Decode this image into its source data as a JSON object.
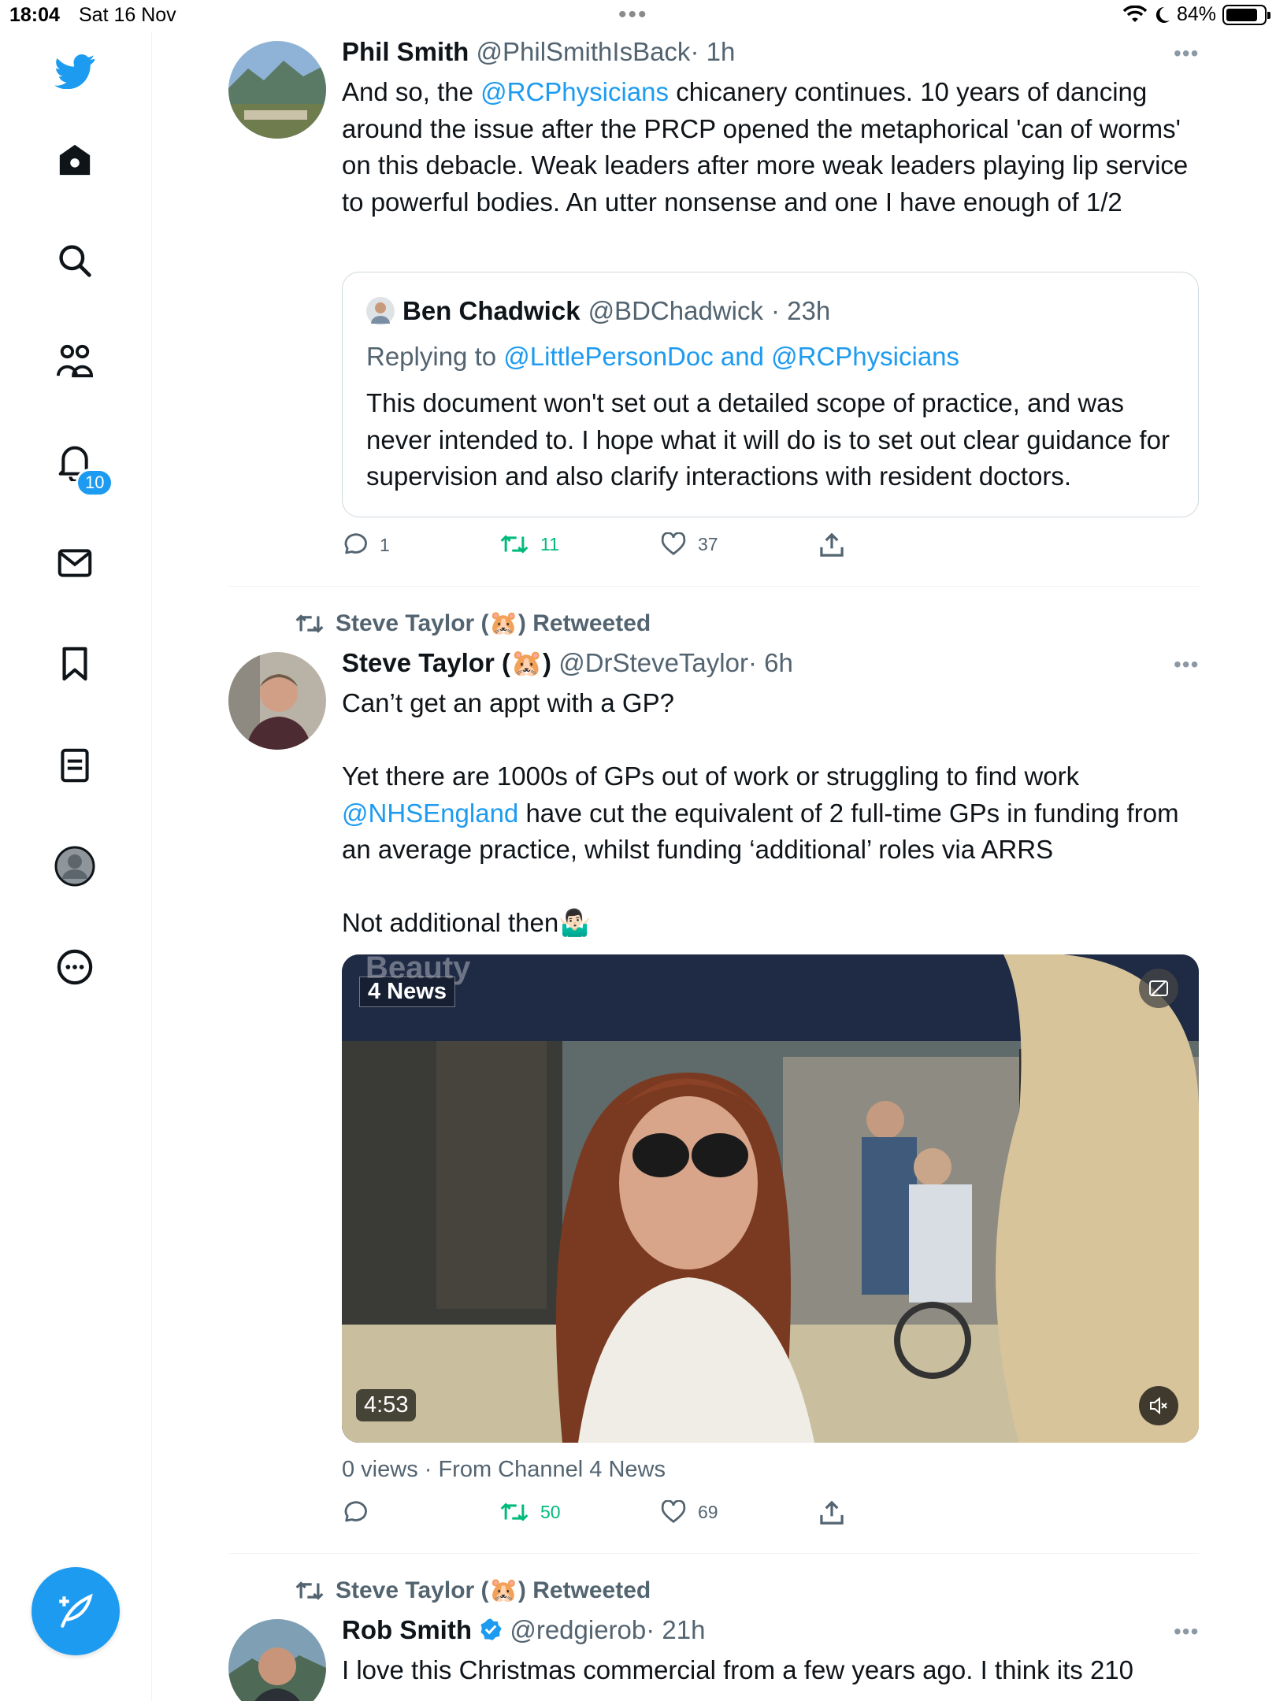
{
  "status_bar": {
    "time": "18:04",
    "date": "Sat 16 Nov",
    "battery": "84%",
    "battery_level": 0.84
  },
  "sidebar": {
    "items": [
      "twitter-logo",
      "home-icon",
      "search-icon",
      "communities-icon",
      "notifications-icon",
      "messages-icon",
      "bookmarks-icon",
      "lists-icon",
      "profile-icon",
      "more-icon"
    ],
    "notification_count": "10"
  },
  "tweet1": {
    "name": "Phil Smith",
    "handle": "@PhilSmithIsBack",
    "time": "· 1h",
    "text_pre": "And so, the ",
    "mention": "@RCPhysicians",
    "text_post": " chicanery continues. 10 years of dancing around the issue after the PRCP opened the metaphorical 'can of worms' on this debacle. Weak leaders after more weak leaders playing lip service to powerful bodies. An utter nonsense and one I have enough of 1/2",
    "quote": {
      "name": "Ben Chadwick",
      "handle": "@BDChadwick",
      "time": "· 23h",
      "replying_to_label": "Replying to",
      "replying_to_users": "@LittlePersonDoc and @RCPhysicians",
      "text": "This document won't set out a detailed scope of practice, and was never intended to. I hope what it will do is to set out clear guidance for supervision and also clarify interactions with resident doctors."
    },
    "replies": "1",
    "retweets": "11",
    "likes": "37"
  },
  "tweet2": {
    "retweeted_by": "Steve Taylor (🐹) Retweeted",
    "name": "Steve Taylor (🐹)",
    "handle": "@DrSteveTaylor",
    "time": "· 6h",
    "line1": "Can’t get an appt with a GP?",
    "line2": "Yet there are 1000s of GPs out of work or struggling to find work",
    "mention": "@NHSEngland",
    "line3": " have cut the equivalent of 2 full-time GPs in funding from an average practice, whilst funding ‘additional’ roles via ARRS",
    "line4": "Not additional then🤷🏻‍♂️",
    "video": {
      "logo": "4 News",
      "duration": "4:53",
      "watermark": "Beauty"
    },
    "views_line": "0 views · From Channel 4 News",
    "retweets": "50",
    "likes": "69"
  },
  "tweet3": {
    "retweeted_by": "Steve Taylor (🐹) Retweeted",
    "name": "Rob Smith",
    "handle": "@redgierob",
    "time": "· 21h",
    "text": "I love this Christmas commercial from a few years ago.  I think its 210"
  },
  "colors": {
    "accent": "#1d9bf0",
    "retweet_green": "#00ba7c",
    "secondary_text": "#536471"
  }
}
